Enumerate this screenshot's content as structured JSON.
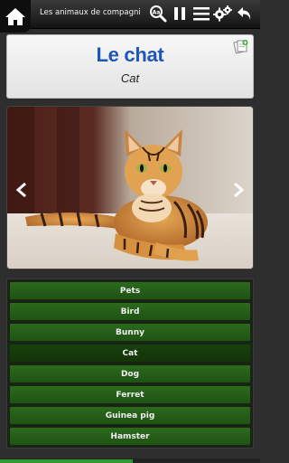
{
  "toolbar": {
    "title": "Les animaux de compagnie..."
  },
  "card": {
    "word": "Le chat",
    "translation": "Cat"
  },
  "answers": [
    "Pets",
    "Bird",
    "Bunny",
    "Cat",
    "Dog",
    "Ferret",
    "Guinea pig",
    "Hamster"
  ],
  "selected_answer_index": 3,
  "progress_fraction": 0.51,
  "colors": {
    "word_blue": "#1f56b8",
    "answer_green": "#2c6a1d",
    "answer_selected": "#173f0c",
    "progress": "#2f9b2f"
  }
}
